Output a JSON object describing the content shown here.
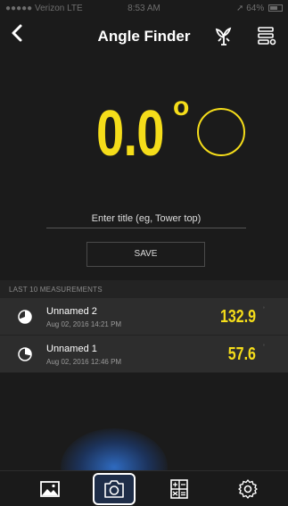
{
  "status": {
    "carrier": "●●●●● Verizon  LTE",
    "time": "8:53 AM",
    "battery": "64%"
  },
  "header": {
    "title": "Angle Finder",
    "back_icon": "chevron-left-icon"
  },
  "reading": {
    "value": "0.0",
    "degree_symbol": "o"
  },
  "input": {
    "placeholder": "Enter title (eg, Tower top)",
    "value": ""
  },
  "save_label": "SAVE",
  "section_label": "LAST 10 MEASUREMENTS",
  "measurements": [
    {
      "name": "Unnamed 2",
      "date": "Aug 02, 2016 14:21 PM",
      "value": "132.9",
      "deg": "°"
    },
    {
      "name": "Unnamed 1",
      "date": "Aug 02, 2016 12:46 PM",
      "value": "57.6",
      "deg": "°"
    }
  ],
  "colors": {
    "accent": "#f5dd1a",
    "background": "#1b1b1b",
    "row": "#2d2d2d",
    "tab_glow": "#3278dc"
  },
  "tabs": [
    "gallery-icon",
    "camera-icon",
    "calculator-icon",
    "settings-icon"
  ]
}
